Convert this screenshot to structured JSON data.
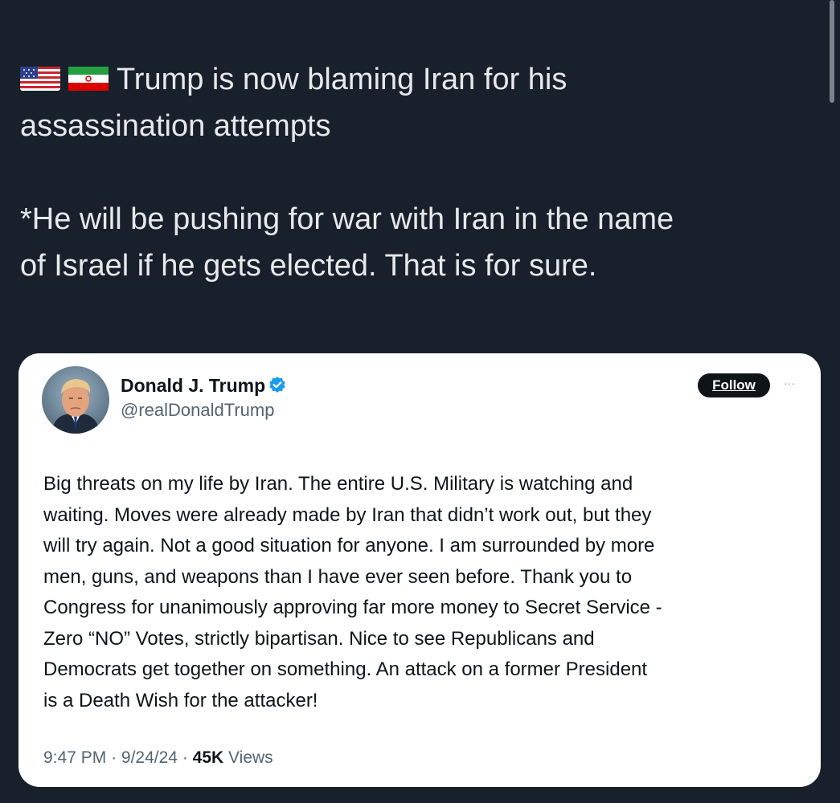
{
  "post": {
    "line1": "Trump is now blaming Iran for his",
    "line2": "assassination attempts",
    "line3": "*He will be pushing for war with Iran in the name",
    "line4": "of Israel if he gets elected. That is for sure.",
    "flags": [
      "us-flag-icon",
      "iran-flag-icon"
    ]
  },
  "quoted_tweet": {
    "display_name": "Donald J. Trump",
    "handle": "@realDonaldTrump",
    "follow_label": "Follow",
    "more_label": "···",
    "body_lines": [
      "Big threats on my life by Iran. The entire U.S. Military is watching and",
      "waiting. Moves were already made by Iran that didn’t work out, but they",
      "will try again. Not a good situation for anyone. I am surrounded by more",
      "men, guns, and weapons than I have ever seen before. Thank you to",
      "Congress for unanimously approving far more money to Secret Service -",
      "Zero “NO” Votes, strictly bipartisan. Nice to see Republicans and",
      "Democrats get together on something. An attack on a former President",
      "is a Death Wish for the attacker!"
    ],
    "time": "9:47 PM",
    "date": "9/24/24",
    "views_count": "45K",
    "views_label": "Views",
    "separator": "·"
  },
  "colors": {
    "background": "#17202b",
    "post_text": "#e7e9ea",
    "card_background": "#ffffff",
    "verified_badge": "#1d9bf0",
    "secondary_text": "#536471",
    "follow_button": "#0f1419"
  }
}
